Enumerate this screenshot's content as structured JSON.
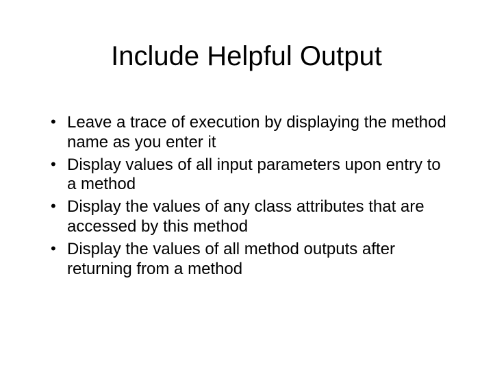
{
  "slide": {
    "title": "Include Helpful Output",
    "bullets": [
      "Leave a trace of execution by displaying the method name as you enter it",
      "Display values of all input parameters upon entry to a method",
      "Display the values of any class attributes that are accessed by this method",
      "Display the values of all method outputs after returning from a method"
    ]
  }
}
